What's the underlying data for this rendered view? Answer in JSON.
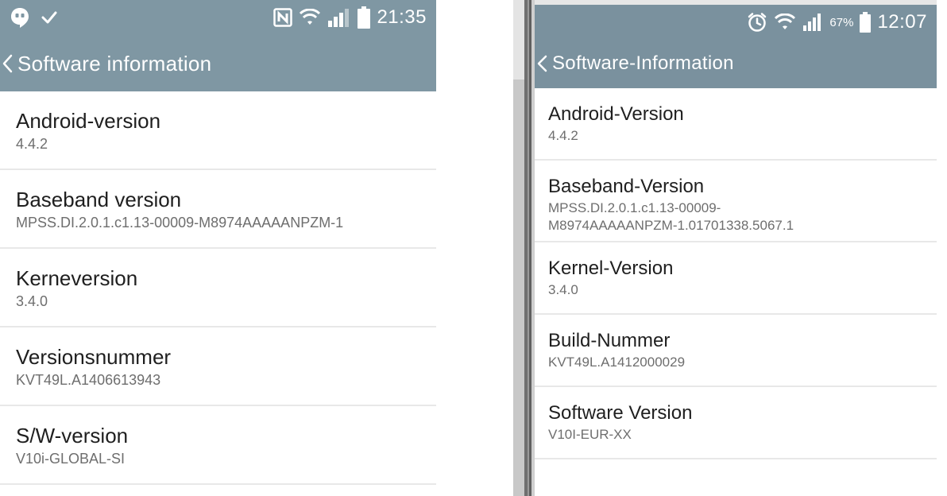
{
  "left_screen": {
    "statusbar": {
      "icons_left": [
        "hangouts-icon",
        "check-icon"
      ],
      "icons_right": [
        "nfc-icon",
        "wifi-icon",
        "signal-icon",
        "battery-icon"
      ],
      "clock": "21:35"
    },
    "title": "Software information",
    "items": [
      {
        "title": "Android-version",
        "value": "4.4.2"
      },
      {
        "title": "Baseband version",
        "value": "MPSS.DI.2.0.1.c1.13-00009-M8974AAAAANPZM-1"
      },
      {
        "title": "Kerneversion",
        "value": "3.4.0"
      },
      {
        "title": "Versionsnummer",
        "value": "KVT49L.A1406613943"
      },
      {
        "title": "S/W-version",
        "value": "V10i-GLOBAL-SI"
      }
    ]
  },
  "right_screen": {
    "statusbar": {
      "icons_right": [
        "alarm-icon",
        "wifi-icon",
        "signal-icon",
        "battery-icon"
      ],
      "battery_percent": "67%",
      "clock": "12:07"
    },
    "title": "Software-Information",
    "items": [
      {
        "title": "Android-Version",
        "value": "4.4.2"
      },
      {
        "title": "Baseband-Version",
        "value": "MPSS.DI.2.0.1.c1.13-00009-\nM8974AAAAANPZM-1.01701338.5067.1"
      },
      {
        "title": "Kernel-Version",
        "value": "3.4.0"
      },
      {
        "title": "Build-Nummer",
        "value": "KVT49L.A1412000029"
      },
      {
        "title": "Software Version",
        "value": "V10I-EUR-XX"
      }
    ]
  },
  "colors": {
    "appbar_left": "#7f97a3",
    "appbar_right": "#7a919e",
    "title_text": "#1f1f1f",
    "value_text": "#6e6e6e",
    "divider": "#e8e8e8"
  }
}
